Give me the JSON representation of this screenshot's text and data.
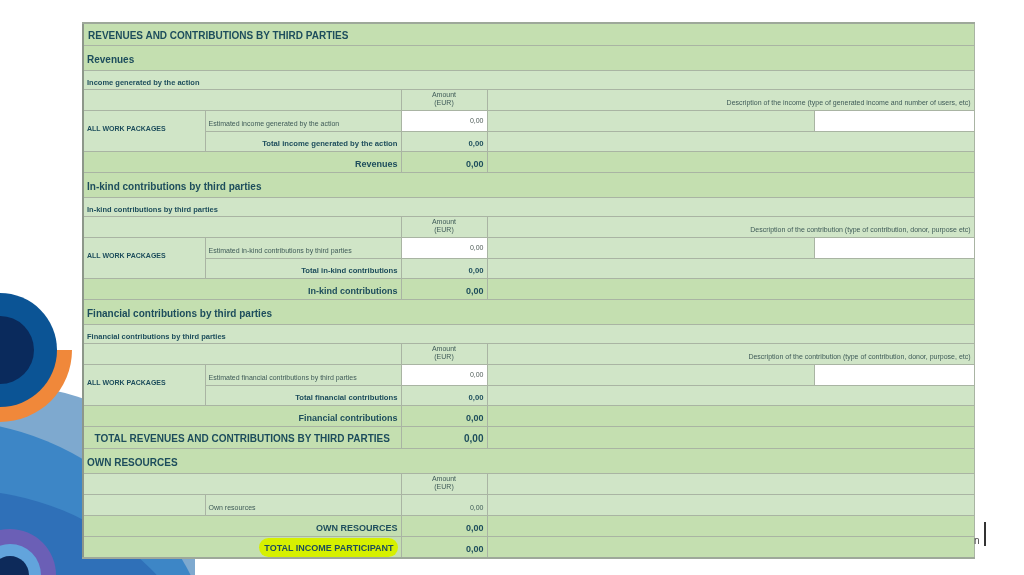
{
  "slide": {
    "edge_text": "n"
  },
  "sheet": {
    "rows": [
      {
        "kind": "title",
        "text": "REVENUES AND CONTRIBUTIONS BY THIRD PARTIES"
      },
      {
        "kind": "section",
        "text": "Revenues"
      },
      {
        "kind": "subsection",
        "text": "Income generated by the action"
      },
      {
        "kind": "header",
        "amount": "Amount (EUR)",
        "description": "Description of the income (type of generated income and number of users, etc)"
      },
      {
        "kind": "entry",
        "group": "ALL WORK PACKAGES",
        "label": "Estimated income generated by the action",
        "amount": "0,00",
        "editable": true
      },
      {
        "kind": "total",
        "label": "Total income generated by the action",
        "amount": "0,00",
        "highlighted": false
      },
      {
        "kind": "sum",
        "label": "Revenues",
        "amount": "0,00",
        "highlighted": false
      },
      {
        "kind": "section",
        "text": "In-kind contributions by third parties"
      },
      {
        "kind": "subsection",
        "text": "In-kind contributions by third parties"
      },
      {
        "kind": "header",
        "amount": "Amount (EUR)",
        "description": "Description of the contribution (type of contribution, donor, purpose etc)"
      },
      {
        "kind": "entry",
        "group": "ALL WORK PACKAGES",
        "label": "Estimated in-kind contributions by third parties",
        "amount": "0,00",
        "editable": true
      },
      {
        "kind": "total",
        "label": "Total in-kind contributions",
        "amount": "0,00",
        "highlighted": false
      },
      {
        "kind": "sum",
        "label": "In-kind contributions",
        "amount": "0,00",
        "highlighted": false
      },
      {
        "kind": "section",
        "text": "Financial contributions by third parties"
      },
      {
        "kind": "subsection",
        "text": "Financial contributions by third parties"
      },
      {
        "kind": "header",
        "amount": "Amount (EUR)",
        "description": "Description of the contribution (type of contribution, donor, purpose, etc)"
      },
      {
        "kind": "entry",
        "group": "ALL WORK PACKAGES",
        "label": "Estimated financial contributions by third parties",
        "amount": "0,00",
        "editable": true
      },
      {
        "kind": "total",
        "label": "Total financial contributions",
        "amount": "0,00",
        "highlighted": false
      },
      {
        "kind": "sum",
        "label": "Financial contributions",
        "amount": "0,00",
        "highlighted": false
      },
      {
        "kind": "grand_total",
        "label": "TOTAL REVENUES AND CONTRIBUTIONS BY THIRD PARTIES",
        "amount": "0,00",
        "highlighted": false
      },
      {
        "kind": "section",
        "text": "OWN RESOURCES"
      },
      {
        "kind": "header",
        "amount": "Amount (EUR)"
      },
      {
        "kind": "entry",
        "label": "Own resources",
        "amount": "0,00",
        "editable": false
      },
      {
        "kind": "sum",
        "label": "OWN RESOURCES",
        "amount": "0,00",
        "highlighted": false
      },
      {
        "kind": "sum",
        "label": "TOTAL INCOME PARTICIPANT",
        "amount": "0,00",
        "highlighted": true
      }
    ]
  }
}
